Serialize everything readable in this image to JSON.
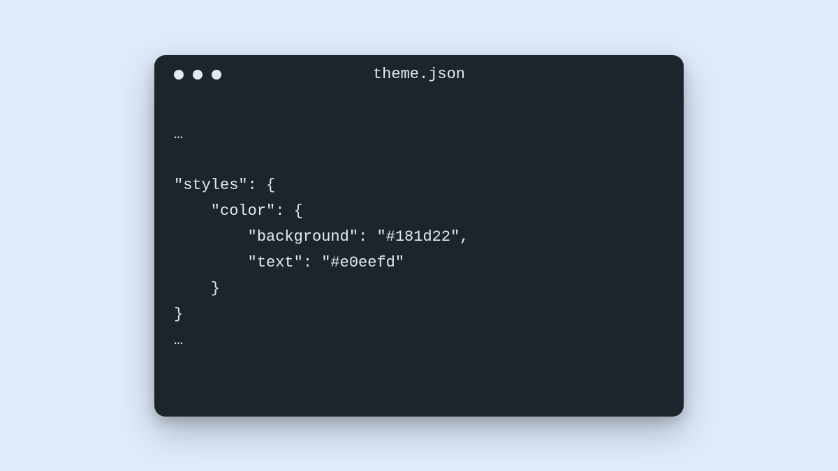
{
  "window": {
    "title": "theme.json"
  },
  "code": {
    "line1": "…",
    "line2": "",
    "line3": "\"styles\": {",
    "line4": "    \"color\": {",
    "line5": "        \"background\": \"#181d22\",",
    "line6": "        \"text\": \"#e0eefd\"",
    "line7": "    }",
    "line8": "}",
    "line9": "…"
  }
}
